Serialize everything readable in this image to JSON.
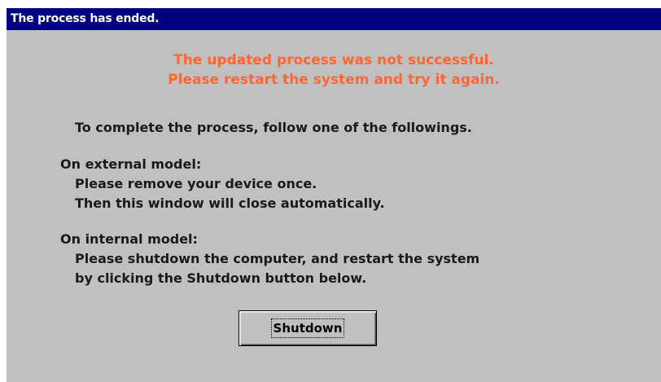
{
  "dialog": {
    "title": "The process has ended.",
    "error_line_1": "The updated process was not successful.",
    "error_line_2": "Please restart the system and try it again.",
    "instruction": "To complete the process, follow one of the followings.",
    "external": {
      "heading": "On external model:",
      "line_1": "Please remove your device once.",
      "line_2": "Then this window will close automatically."
    },
    "internal": {
      "heading": "On internal model:",
      "line_1": "Please shutdown the computer, and restart the system",
      "line_2": "by clicking the Shutdown button below."
    },
    "shutdown_label": "Shutdown"
  },
  "colors": {
    "title_bar": "#000080",
    "dialog_background": "#c0c0c0",
    "error_text": "#ff6633"
  }
}
